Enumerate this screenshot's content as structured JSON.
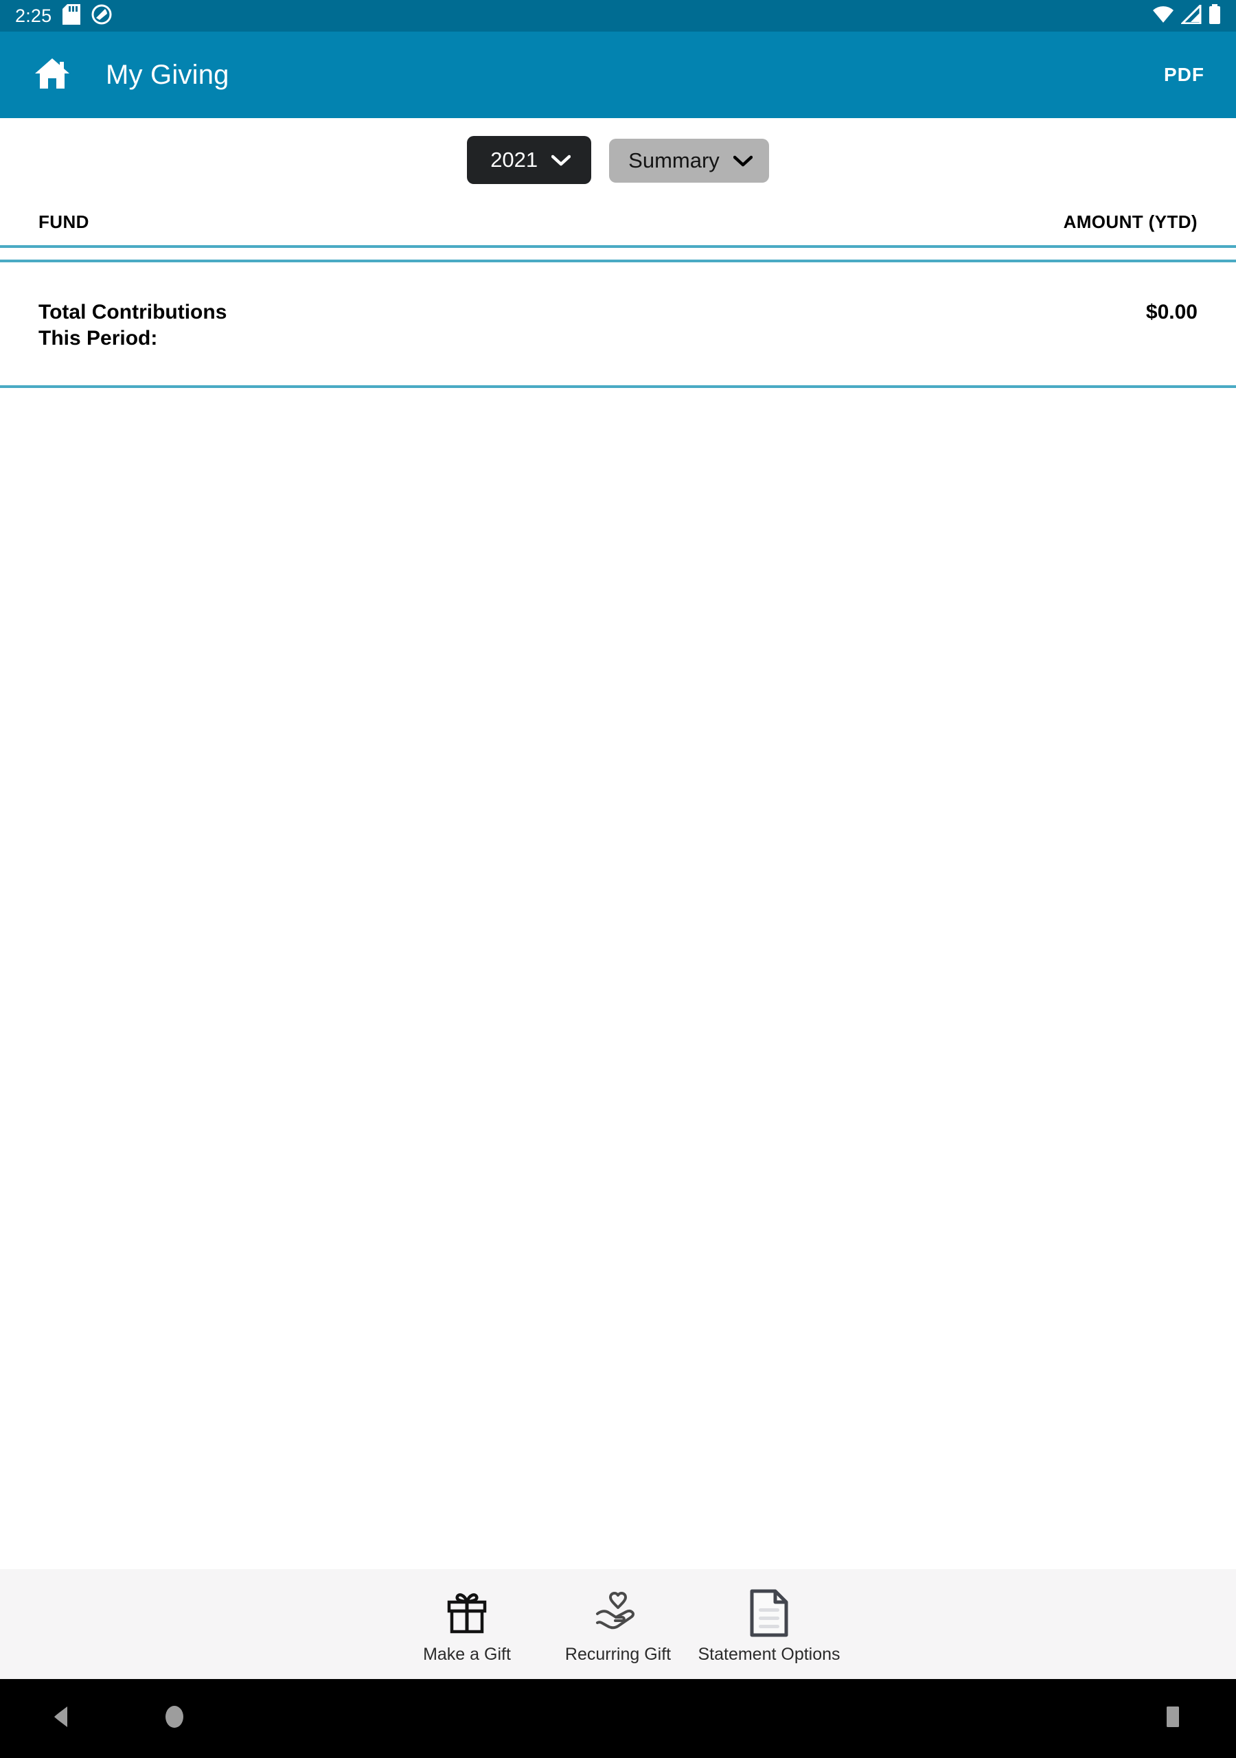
{
  "status_bar": {
    "time": "2:25",
    "left_icons": [
      "sd-card-icon",
      "do-not-disturb-icon"
    ],
    "right_icons": [
      "wifi-icon",
      "cellular-signal-icon",
      "battery-icon"
    ],
    "background_color": "#006c92"
  },
  "app_bar": {
    "home_icon": "home-icon",
    "title": "My Giving",
    "pdf_label": "PDF",
    "background_color": "#0383b0"
  },
  "filters": {
    "year": {
      "label": "2021",
      "icon": "chevron-down-icon",
      "background_color": "#212325",
      "text_color": "#ffffff"
    },
    "view": {
      "label": "Summary",
      "icon": "chevron-down-icon",
      "background_color": "#b2b2b2",
      "text_color": "#141414"
    }
  },
  "table": {
    "columns": [
      "FUND",
      "AMOUNT (YTD)"
    ],
    "rows": [],
    "divider_color": "#4aaac4",
    "total": {
      "label": "Total Contributions This Period:",
      "label_line1": "Total Contributions",
      "label_line2": "This Period:",
      "amount": "$0.00"
    }
  },
  "bottom_nav": {
    "background_color": "#f6f5f6",
    "items": [
      {
        "label": "Make a Gift",
        "icon": "gift-icon"
      },
      {
        "label": "Recurring Gift",
        "icon": "hand-heart-icon"
      },
      {
        "label": "Statement Options",
        "icon": "document-icon"
      }
    ]
  },
  "android_nav": {
    "background_color": "#000000",
    "buttons": [
      {
        "name": "back",
        "icon": "triangle-back-icon"
      },
      {
        "name": "home",
        "icon": "circle-home-icon"
      },
      {
        "name": "recents",
        "icon": "square-recents-icon"
      }
    ]
  }
}
